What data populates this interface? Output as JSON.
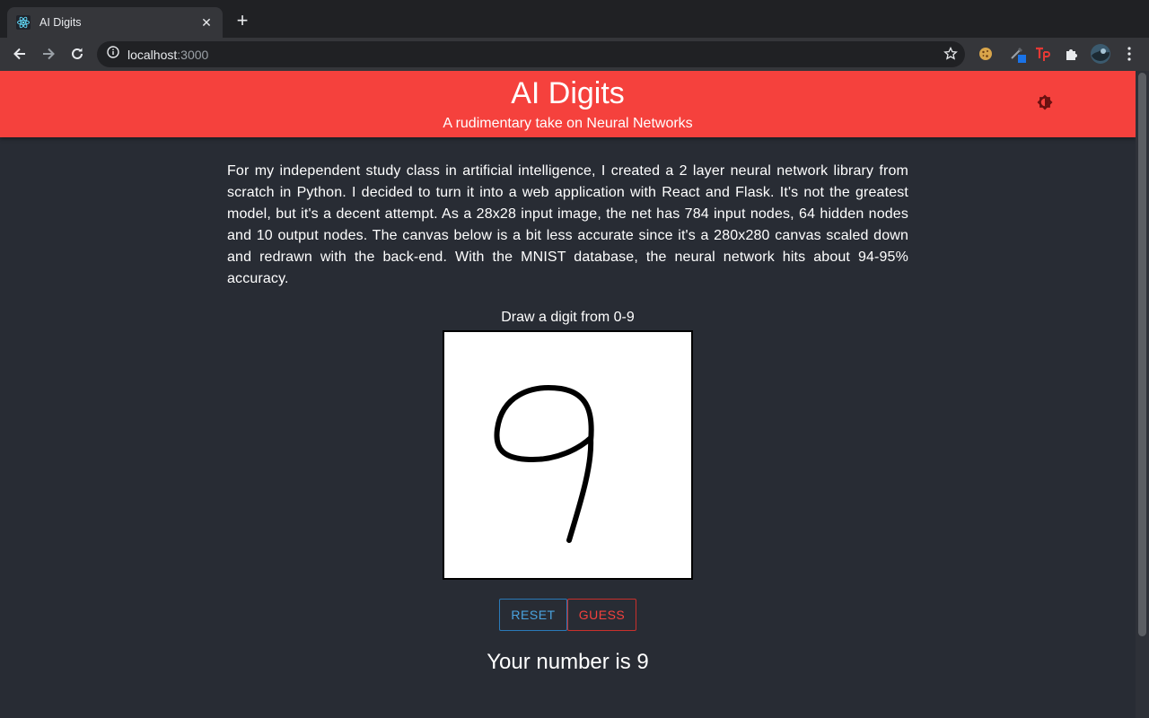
{
  "browser": {
    "tab_title": "AI Digits",
    "url_host": "localhost",
    "url_port": ":3000"
  },
  "header": {
    "title": "AI Digits",
    "subtitle": "A rudimentary take on Neural Networks",
    "toggle_icon": "theme-toggle-icon"
  },
  "intro": {
    "text": "For my independent study class in artificial intelligence, I created a 2 layer neural network library from scratch in Python. I decided to turn it into a web application with React and Flask. It's not the greatest model, but it's a decent attempt. As a 28x28 input image, the net has 784 input nodes, 64 hidden nodes and 10 output nodes. The canvas below is a bit less accurate since it's a 280x280 canvas scaled down and redrawn with the back-end. With the MNIST database, the neural network hits about 94-95% accuracy."
  },
  "canvas": {
    "label": "Draw a digit from 0-9"
  },
  "buttons": {
    "reset_label": "RESET",
    "guess_label": "GUESS"
  },
  "result": {
    "text": "Your number is 9"
  },
  "colors": {
    "header": "#f5413d",
    "background": "#282c34",
    "reset": "#4aa3df",
    "guess": "#f5413d"
  }
}
